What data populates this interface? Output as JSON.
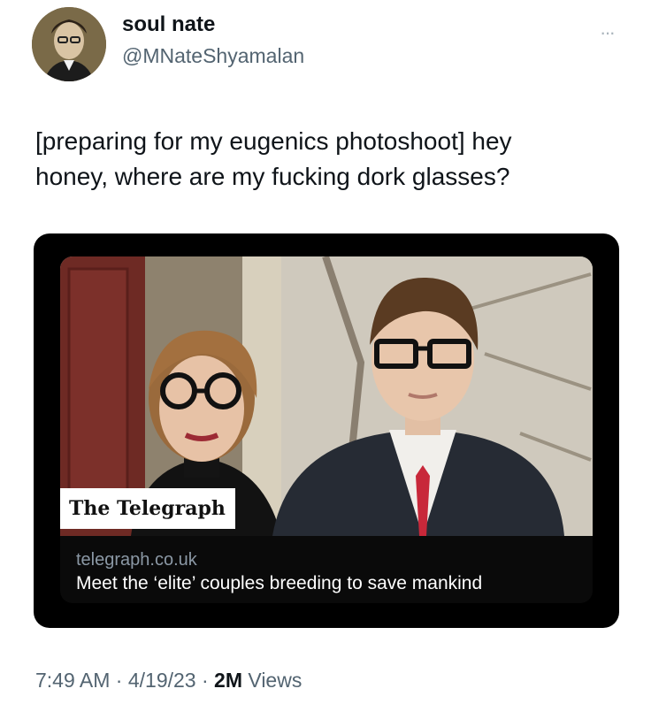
{
  "author": {
    "display_name": "soul nate",
    "handle": "@MNateShyamalan",
    "avatar_icon": "avatar-portrait"
  },
  "more_icon": "···",
  "tweet": {
    "lines": [
      "[preparing for my eugenics photoshoot] hey",
      "honey, where are my fucking dork glasses?"
    ]
  },
  "card": {
    "publisher": "The Telegraph",
    "domain": "telegraph.co.uk",
    "title": "Meet the ‘elite’ couples breeding to save mankind"
  },
  "meta": {
    "time": "7:49 AM",
    "separator_1": " · ",
    "date": "4/19/23",
    "separator_2": " · ",
    "views_count": "2M",
    "views_label": " Views"
  },
  "colors": {
    "text": "#0f1419",
    "secondary": "#536471",
    "card_bg": "#000000",
    "tie_red": "#c8283a"
  }
}
